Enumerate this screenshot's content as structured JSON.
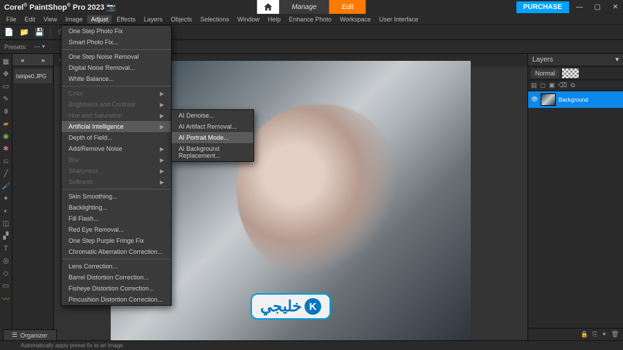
{
  "titlebar": {
    "brand": "Corel",
    "product": "PaintShop",
    "edition": "Pro",
    "version": "2023",
    "home_label": "Home",
    "mode_manage": "Manage",
    "mode_edit": "Edit",
    "purchase": "PURCHASE"
  },
  "menubar": {
    "items": [
      "File",
      "Edit",
      "View",
      "Image",
      "Adjust",
      "Effects",
      "Layers",
      "Objects",
      "Selections",
      "Window",
      "Help",
      "Enhance Photo",
      "Workspace",
      "User Interface"
    ],
    "active_index": 4
  },
  "toolbar": {
    "icons": [
      "file",
      "open",
      "save",
      "print",
      "undo",
      "redo",
      "cut",
      "copy",
      "paste",
      "grid"
    ]
  },
  "optionsbar": {
    "label_preset": "Presets:",
    "dropdown": "—",
    "icons": [
      "plus",
      "down"
    ]
  },
  "lefttabs": {
    "history_tab": "«",
    "doc_label": "Istripe0.JPG"
  },
  "adjust_menu": {
    "items": [
      {
        "label": "One Step Photo Fix",
        "enabled": true
      },
      {
        "label": "Smart Photo Fix...",
        "enabled": true
      },
      {
        "label": "One Step Noise Removal",
        "enabled": true
      },
      {
        "label": "Digital Noise Removal...",
        "enabled": true
      },
      {
        "label": "White Balance...",
        "enabled": true
      },
      {
        "sep": true
      },
      {
        "label": "Color",
        "enabled": false,
        "submenu": true
      },
      {
        "label": "Brightness and Contrast",
        "enabled": false,
        "submenu": true
      },
      {
        "label": "Hue and Saturation",
        "enabled": false,
        "submenu": true
      },
      {
        "label": "Artificial Intelligence",
        "enabled": true,
        "submenu": true,
        "highlight": true
      },
      {
        "label": "Depth of Field...",
        "enabled": true
      },
      {
        "label": "Add/Remove Noise",
        "enabled": true,
        "submenu": true
      },
      {
        "label": "Blur",
        "enabled": false,
        "submenu": true
      },
      {
        "label": "Sharpness",
        "enabled": false,
        "submenu": true
      },
      {
        "label": "Softness",
        "enabled": false,
        "submenu": true
      },
      {
        "sep": true
      },
      {
        "label": "Skin Smoothing...",
        "enabled": true
      },
      {
        "label": "Backlighting...",
        "enabled": true
      },
      {
        "label": "Fill Flash...",
        "enabled": true
      },
      {
        "label": "Red Eye Removal...",
        "enabled": true
      },
      {
        "label": "One Step Purple Fringe Fix",
        "enabled": true
      },
      {
        "label": "Chromatic Aberration Correction...",
        "enabled": true
      },
      {
        "sep": true
      },
      {
        "label": "Lens Correction...",
        "enabled": true
      },
      {
        "label": "Barrel Distortion Correction...",
        "enabled": true
      },
      {
        "label": "Fisheye Distortion Correction...",
        "enabled": true
      },
      {
        "label": "Pincushion Distortion Correction...",
        "enabled": true
      }
    ]
  },
  "ai_submenu": {
    "items": [
      {
        "label": "AI Denoise..."
      },
      {
        "label": "AI Artifact Removal..."
      },
      {
        "sep": true
      },
      {
        "label": "AI Portrait Mode...",
        "highlight": true
      },
      {
        "label": "AI Background Replacement..."
      }
    ]
  },
  "layers_panel": {
    "title": "Layers",
    "blend_mode": "Normal",
    "layer_name": "Background"
  },
  "statusbar": {
    "hint": "Automatically apply preset fix to an image.",
    "organizer": "Organizer"
  },
  "watermark": {
    "text": "خليجي",
    "badge": "K"
  }
}
